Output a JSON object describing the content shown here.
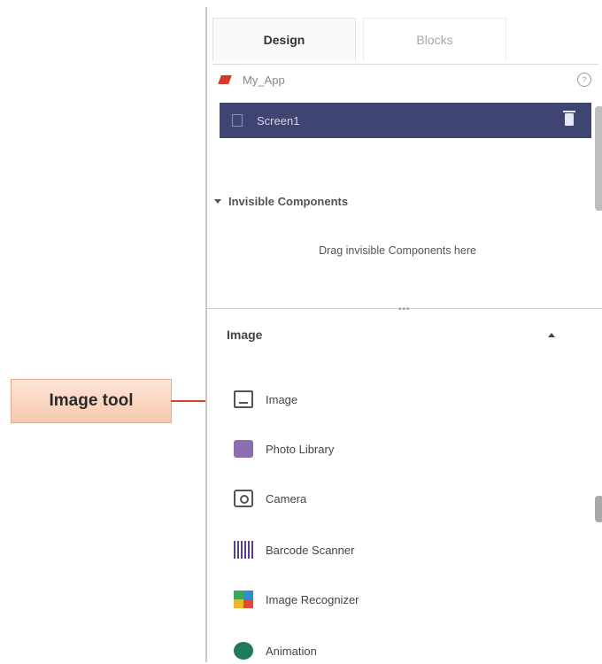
{
  "callout": {
    "label": "Image tool"
  },
  "tabs": {
    "design": "Design",
    "blocks": "Blocks"
  },
  "tree": {
    "app_name": "My_App",
    "screen_name": "Screen1"
  },
  "invisible": {
    "title": "Invisible Components",
    "hint": "Drag invisible Components here"
  },
  "palette": {
    "section_title": "Image",
    "items": [
      {
        "label": "Image",
        "icon": "image-icon"
      },
      {
        "label": "Photo Library",
        "icon": "photo-library-icon"
      },
      {
        "label": "Camera",
        "icon": "camera-icon"
      },
      {
        "label": "Barcode Scanner",
        "icon": "barcode-icon"
      },
      {
        "label": "Image Recognizer",
        "icon": "image-recognizer-icon"
      },
      {
        "label": "Animation",
        "icon": "animation-icon"
      }
    ]
  },
  "colors": {
    "selected_row": "#3f4472",
    "callout_fill": "#f7c9ad",
    "arrow": "#d9402a"
  }
}
